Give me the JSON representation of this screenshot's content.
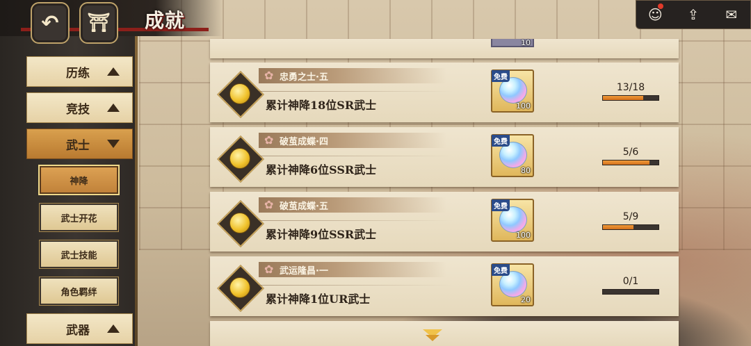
{
  "header": {
    "title": "成就"
  },
  "icons": {
    "back": "back-arrow-icon",
    "home": "castle-icon",
    "avatar": "character-notice-icon",
    "up": "rank-up-icon",
    "mail": "mail-icon"
  },
  "sidebar": {
    "categories": [
      {
        "label": "历练",
        "expanded": false
      },
      {
        "label": "竞技",
        "expanded": false
      },
      {
        "label": "武士",
        "expanded": true
      },
      {
        "label": "武器",
        "expanded": false
      }
    ],
    "subitems": [
      {
        "label": "神降",
        "selected": true
      },
      {
        "label": "武士开花",
        "selected": false
      },
      {
        "label": "武士技能",
        "selected": false
      },
      {
        "label": "角色羁绊",
        "selected": false
      }
    ]
  },
  "achievements": [
    {
      "title": "忠勇之士·五",
      "desc": "累计神降18位SR武士",
      "reward_tag": "免费",
      "reward_qty": "100",
      "progress_text": "13/18",
      "progress": 0.7222
    },
    {
      "title": "破茧成蝶·四",
      "desc": "累计神降6位SSR武士",
      "reward_tag": "免费",
      "reward_qty": "80",
      "progress_text": "5/6",
      "progress": 0.8333
    },
    {
      "title": "破茧成蝶·五",
      "desc": "累计神降9位SSR武士",
      "reward_tag": "免费",
      "reward_qty": "100",
      "progress_text": "5/9",
      "progress": 0.5556
    },
    {
      "title": "武运隆昌·一",
      "desc": "累计神降1位UR武士",
      "reward_tag": "免费",
      "reward_qty": "20",
      "progress_text": "0/1",
      "progress": 0.0
    }
  ],
  "partial_top": {
    "reward_qty": "10"
  },
  "colors": {
    "progress_fill": "#e8842a",
    "active_category": "#c98a3c",
    "header_accent": "#8c1f1a"
  }
}
